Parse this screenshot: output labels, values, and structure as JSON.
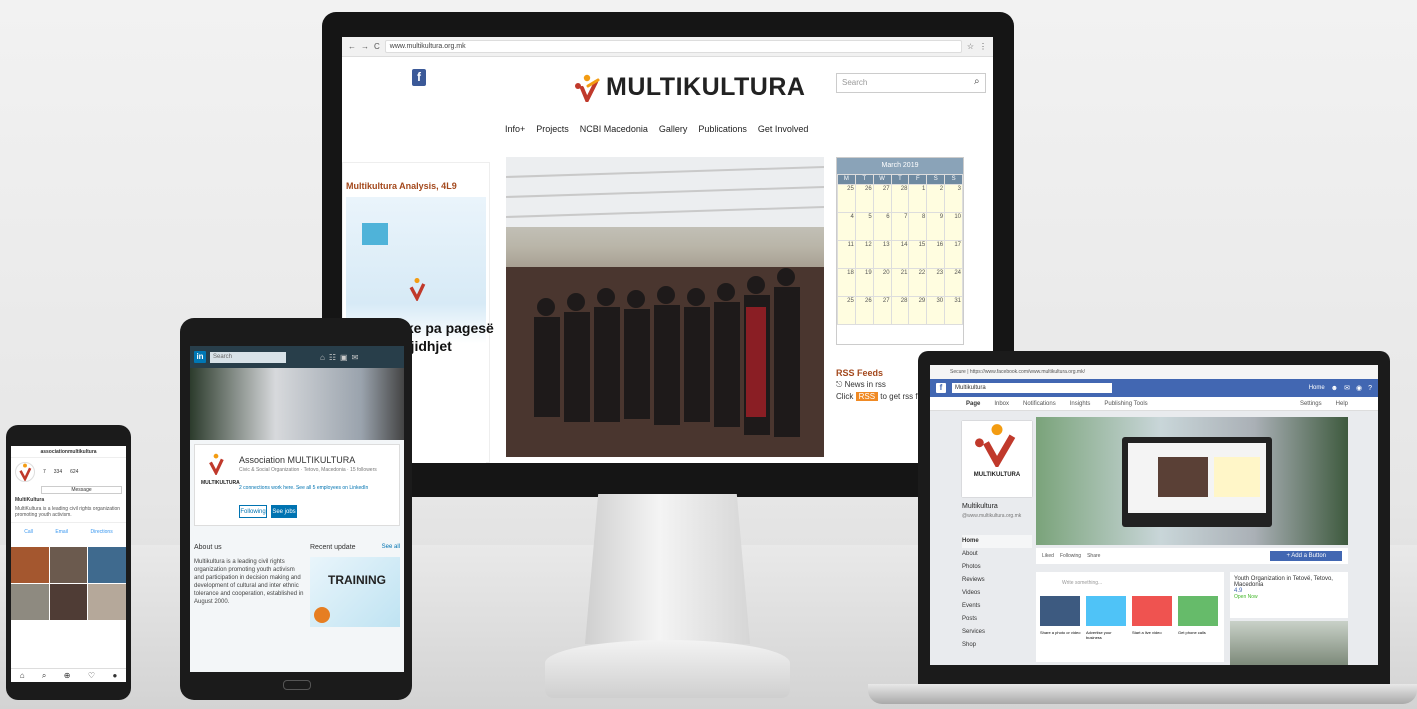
{
  "desktop": {
    "url": "www.multikultura.org.mk",
    "brand": "MULTIKULTURA",
    "search_placeholder": "Search",
    "nav": [
      "Info+",
      "Projects",
      "NCBI Macedonia",
      "Gallery",
      "Publications",
      "Get Involved"
    ],
    "sidebar_title": "Multikultura Analysis, 4L9",
    "poster_text": "ike pa pagesë\ngjidhjet",
    "calendar": {
      "month": "March 2019",
      "weekdays": [
        "M",
        "T",
        "W",
        "T",
        "F",
        "S",
        "S"
      ],
      "days": [
        "25",
        "26",
        "27",
        "28",
        "1",
        "2",
        "3",
        "4",
        "5",
        "6",
        "7",
        "8",
        "9",
        "10",
        "11",
        "12",
        "13",
        "14",
        "15",
        "16",
        "17",
        "18",
        "19",
        "20",
        "21",
        "22",
        "23",
        "24",
        "25",
        "26",
        "27",
        "28",
        "29",
        "30",
        "31"
      ]
    },
    "rss": {
      "title": "RSS Feeds",
      "line1": "News in rss",
      "click": "Click",
      "badge": "RSS",
      "line2": "to get rss feed"
    }
  },
  "tablet": {
    "search_placeholder": "Search",
    "org_name": "Association MULTIKULTURA",
    "org_sub": "Civic & Social Organization · Tetovo, Macedonia · 15 followers",
    "connections": "2 connections work here. See all 5 employees on LinkedIn",
    "following_btn": "Following",
    "see_jobs_btn": "See jobs",
    "about_title": "About us",
    "about_text": "Multikultura is a leading civil rights organization promoting youth activism and participation in decision making and development of cultural and inter ethnic tolerance and cooperation, established in August 2000.",
    "recent_title": "Recent update",
    "see_all": "See all",
    "training_text": "TRAINING",
    "brand_small": "MULTIKULTURA"
  },
  "phone": {
    "username": "associationmultikultura",
    "posts_count": "7",
    "followers_count": "334",
    "following_count": "624",
    "message_btn": "Message",
    "name": "MultiKultura",
    "bio": "MultiKultura is a leading civil rights organization promoting youth activism.",
    "call": "Call",
    "email": "Email",
    "directions": "Directions"
  },
  "laptop": {
    "url": "Secure | https://www.facebook.com/www.multikultura.org.mk/",
    "search_value": "Multikultura",
    "home": "Home",
    "tabs": [
      "Page",
      "Inbox",
      "Notifications",
      "Insights",
      "Publishing Tools"
    ],
    "settings": "Settings",
    "help": "Help",
    "page_name": "Multikultura",
    "page_handle": "@www.multikultura.org.mk",
    "side_items": [
      "Home",
      "About",
      "Photos",
      "Reviews",
      "Videos",
      "Events",
      "Posts",
      "Services",
      "Shop"
    ],
    "liked": "Liked",
    "following": "Following",
    "share": "Share",
    "add_button": "+ Add a Button",
    "write_something": "Write something...",
    "post_options": [
      "Share a photo or video",
      "Advertise your business",
      "Start a live video",
      "Get phone calls"
    ],
    "info_text": "Youth Organization in Tetovë, Tetovo, Macedonia",
    "rating": "4.9",
    "open_now": "Open Now"
  },
  "colors": {
    "facebook_blue": "#4267b2",
    "linkedin_blue": "#0077b5",
    "brand_red": "#c0392b",
    "brand_orange": "#f39c12"
  }
}
